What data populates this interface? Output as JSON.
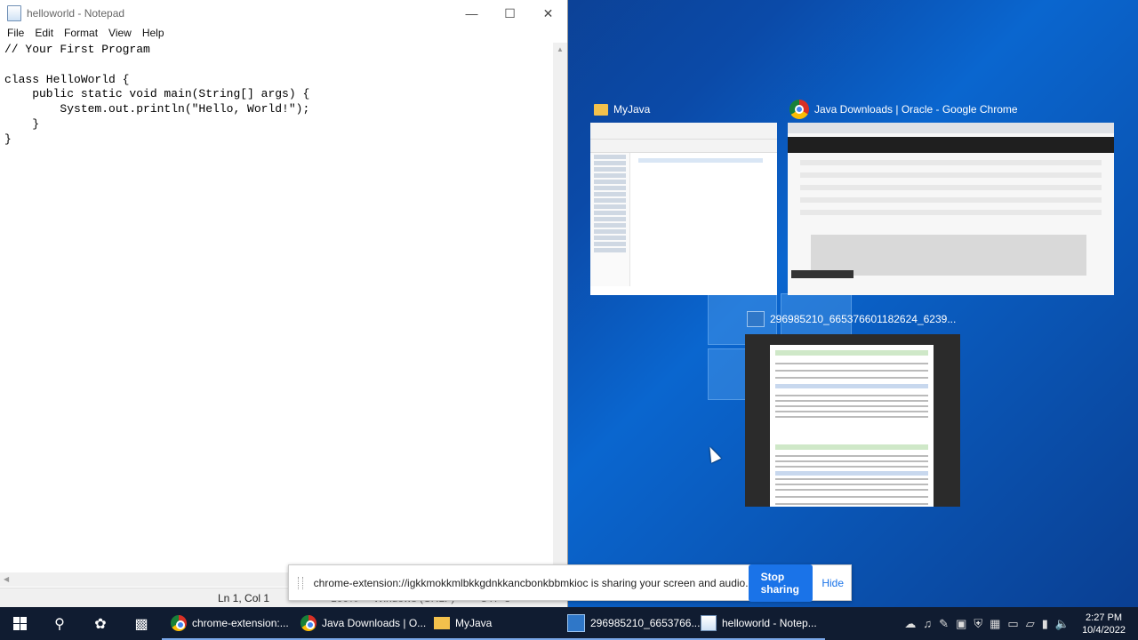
{
  "notepad": {
    "title": "helloworld - Notepad",
    "menu": [
      "File",
      "Edit",
      "Format",
      "View",
      "Help"
    ],
    "content": "// Your First Program\n\nclass HelloWorld {\n    public static void main(String[] args) {\n        System.out.println(\"Hello, World!\");\n    }\n}",
    "status_position": "Ln 1, Col 1",
    "status_zoom": "100%",
    "status_eol": "Windows (CRLF)",
    "status_encoding": "UTF-8"
  },
  "task_view": {
    "windows": [
      {
        "title": "MyJava",
        "icon": "folder-icon"
      },
      {
        "title": "Java Downloads | Oracle - Google Chrome",
        "icon": "chrome-icon"
      },
      {
        "title": "296985210_665376601182624_6239...",
        "icon": "image-icon"
      }
    ]
  },
  "share_bar": {
    "message": "chrome-extension://igkkmokkmlbkkgdnkkancbonkbbmkioc is sharing your screen and audio.",
    "stop_label": "Stop sharing",
    "hide_label": "Hide"
  },
  "taskbar": {
    "apps": [
      {
        "label": "chrome-extension:...",
        "icon": "chrome-icon"
      },
      {
        "label": "Java Downloads | O...",
        "icon": "chrome-icon"
      },
      {
        "label": "MyJava",
        "icon": "folder-icon"
      },
      {
        "label": "296985210_6653766...",
        "icon": "image-icon"
      },
      {
        "label": "helloworld - Notep...",
        "icon": "notepad-icon"
      }
    ],
    "time": "2:27 PM",
    "date": "10/4/2022"
  },
  "colors": {
    "accent": "#1a73e8",
    "taskbar": "#101c31"
  }
}
